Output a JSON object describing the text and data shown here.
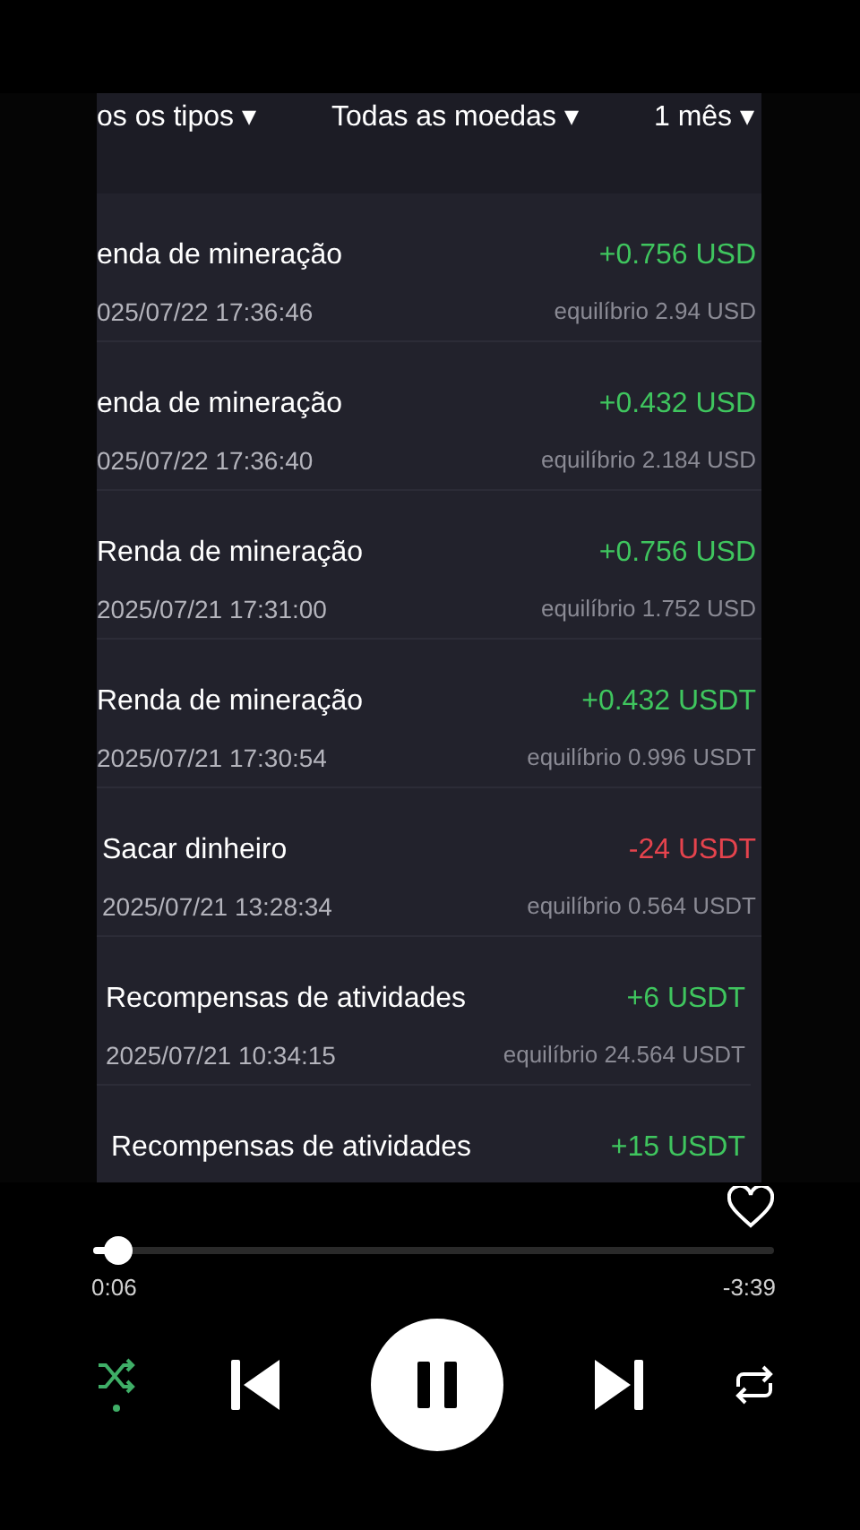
{
  "filters": [
    {
      "label": "os os tipos ▾"
    },
    {
      "label": "Todas as moedas ▾"
    },
    {
      "label": "1 mês ▾"
    }
  ],
  "transactions": [
    {
      "title": "enda de mineração",
      "date": "025/07/22 17:36:46",
      "amount": "+0.756 USD",
      "balance": "equilíbrio 2.94 USD",
      "kind": "income"
    },
    {
      "title": "enda de mineração",
      "date": "025/07/22 17:36:40",
      "amount": "+0.432 USD",
      "balance": "equilíbrio 2.184 USD",
      "kind": "income"
    },
    {
      "title": "Renda de mineração",
      "date": "2025/07/21 17:31:00",
      "amount": "+0.756 USD",
      "balance": "equilíbrio 1.752 USD",
      "kind": "income"
    },
    {
      "title": "Renda de mineração",
      "date": "2025/07/21 17:30:54",
      "amount": "+0.432 USDT",
      "balance": "equilíbrio 0.996 USDT",
      "kind": "income"
    },
    {
      "title": "Sacar dinheiro",
      "date": "2025/07/21 13:28:34",
      "amount": "-24 USDT",
      "balance": "equilíbrio 0.564 USDT",
      "kind": "expense"
    },
    {
      "title": "Recompensas de atividades",
      "date": "2025/07/21 10:34:15",
      "amount": "+6 USDT",
      "balance": "equilíbrio 24.564 USDT",
      "kind": "income"
    },
    {
      "title": "Recompensas de atividades",
      "amount": "+15 USDT",
      "kind": "income"
    }
  ],
  "player": {
    "liked": false,
    "level": 0.037,
    "elapsed": "0:06",
    "remaining": "-3:39",
    "shuffle": true,
    "playing": true
  }
}
